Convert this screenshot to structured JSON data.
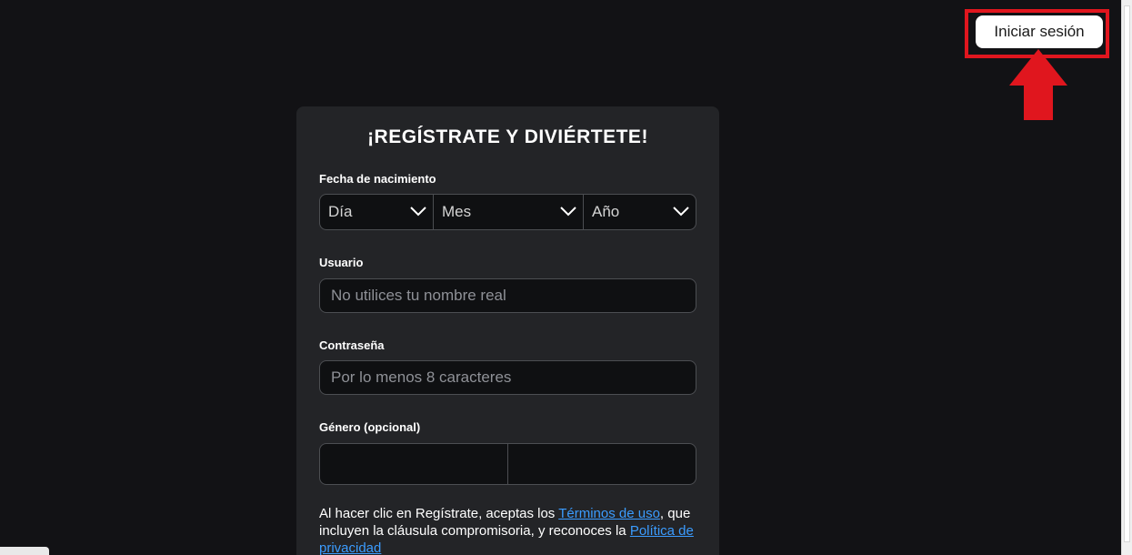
{
  "header": {
    "login_button_label": "Iniciar sesión"
  },
  "colors": {
    "background": "#121215",
    "card": "#232427",
    "highlight": "#e0161e",
    "link": "#3b9cff"
  },
  "form": {
    "title": "¡REGÍSTRATE Y DIVIÉRTETE!",
    "birthdate": {
      "label": "Fecha de nacimiento",
      "day_placeholder": "Día",
      "month_placeholder": "Mes",
      "year_placeholder": "Año"
    },
    "username": {
      "label": "Usuario",
      "placeholder": "No utilices tu nombre real"
    },
    "password": {
      "label": "Contraseña",
      "placeholder": "Por lo menos 8 caracteres"
    },
    "gender": {
      "label": "Género (opcional)"
    },
    "terms": {
      "prefix": "Al hacer clic en Regístrate, aceptas los ",
      "terms_link": "Términos de uso",
      "middle": ", que incluyen la cláusula compromisoria, y reconoces la ",
      "privacy_link": "Política de privacidad"
    }
  },
  "icons": {
    "annotation": "red-up-arrow-icon",
    "dropdown": "chevron-down-icon"
  }
}
